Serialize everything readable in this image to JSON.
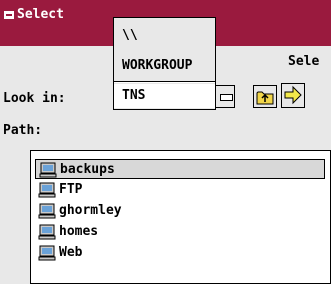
{
  "window": {
    "title": "Select",
    "accent_color": "#9a1a3e"
  },
  "header": {
    "select_hint": "Sele"
  },
  "lookin": {
    "label": "Look in:",
    "dropdown_options": [
      "\\\\",
      "WORKGROUP",
      "TNS"
    ],
    "selected": "TNS"
  },
  "toolbar": {
    "toggle_icon": "rectangle-button-icon",
    "up_icon": "folder-up-icon",
    "go_icon": "arrow-right-icon"
  },
  "path": {
    "label": "Path:"
  },
  "file_list": {
    "items": [
      {
        "label": "backups",
        "icon": "computer-icon",
        "selected": true
      },
      {
        "label": "FTP",
        "icon": "computer-icon",
        "selected": false
      },
      {
        "label": "ghormley",
        "icon": "computer-icon",
        "selected": false
      },
      {
        "label": "homes",
        "icon": "computer-icon",
        "selected": false
      },
      {
        "label": "Web",
        "icon": "computer-icon",
        "selected": false
      }
    ]
  }
}
